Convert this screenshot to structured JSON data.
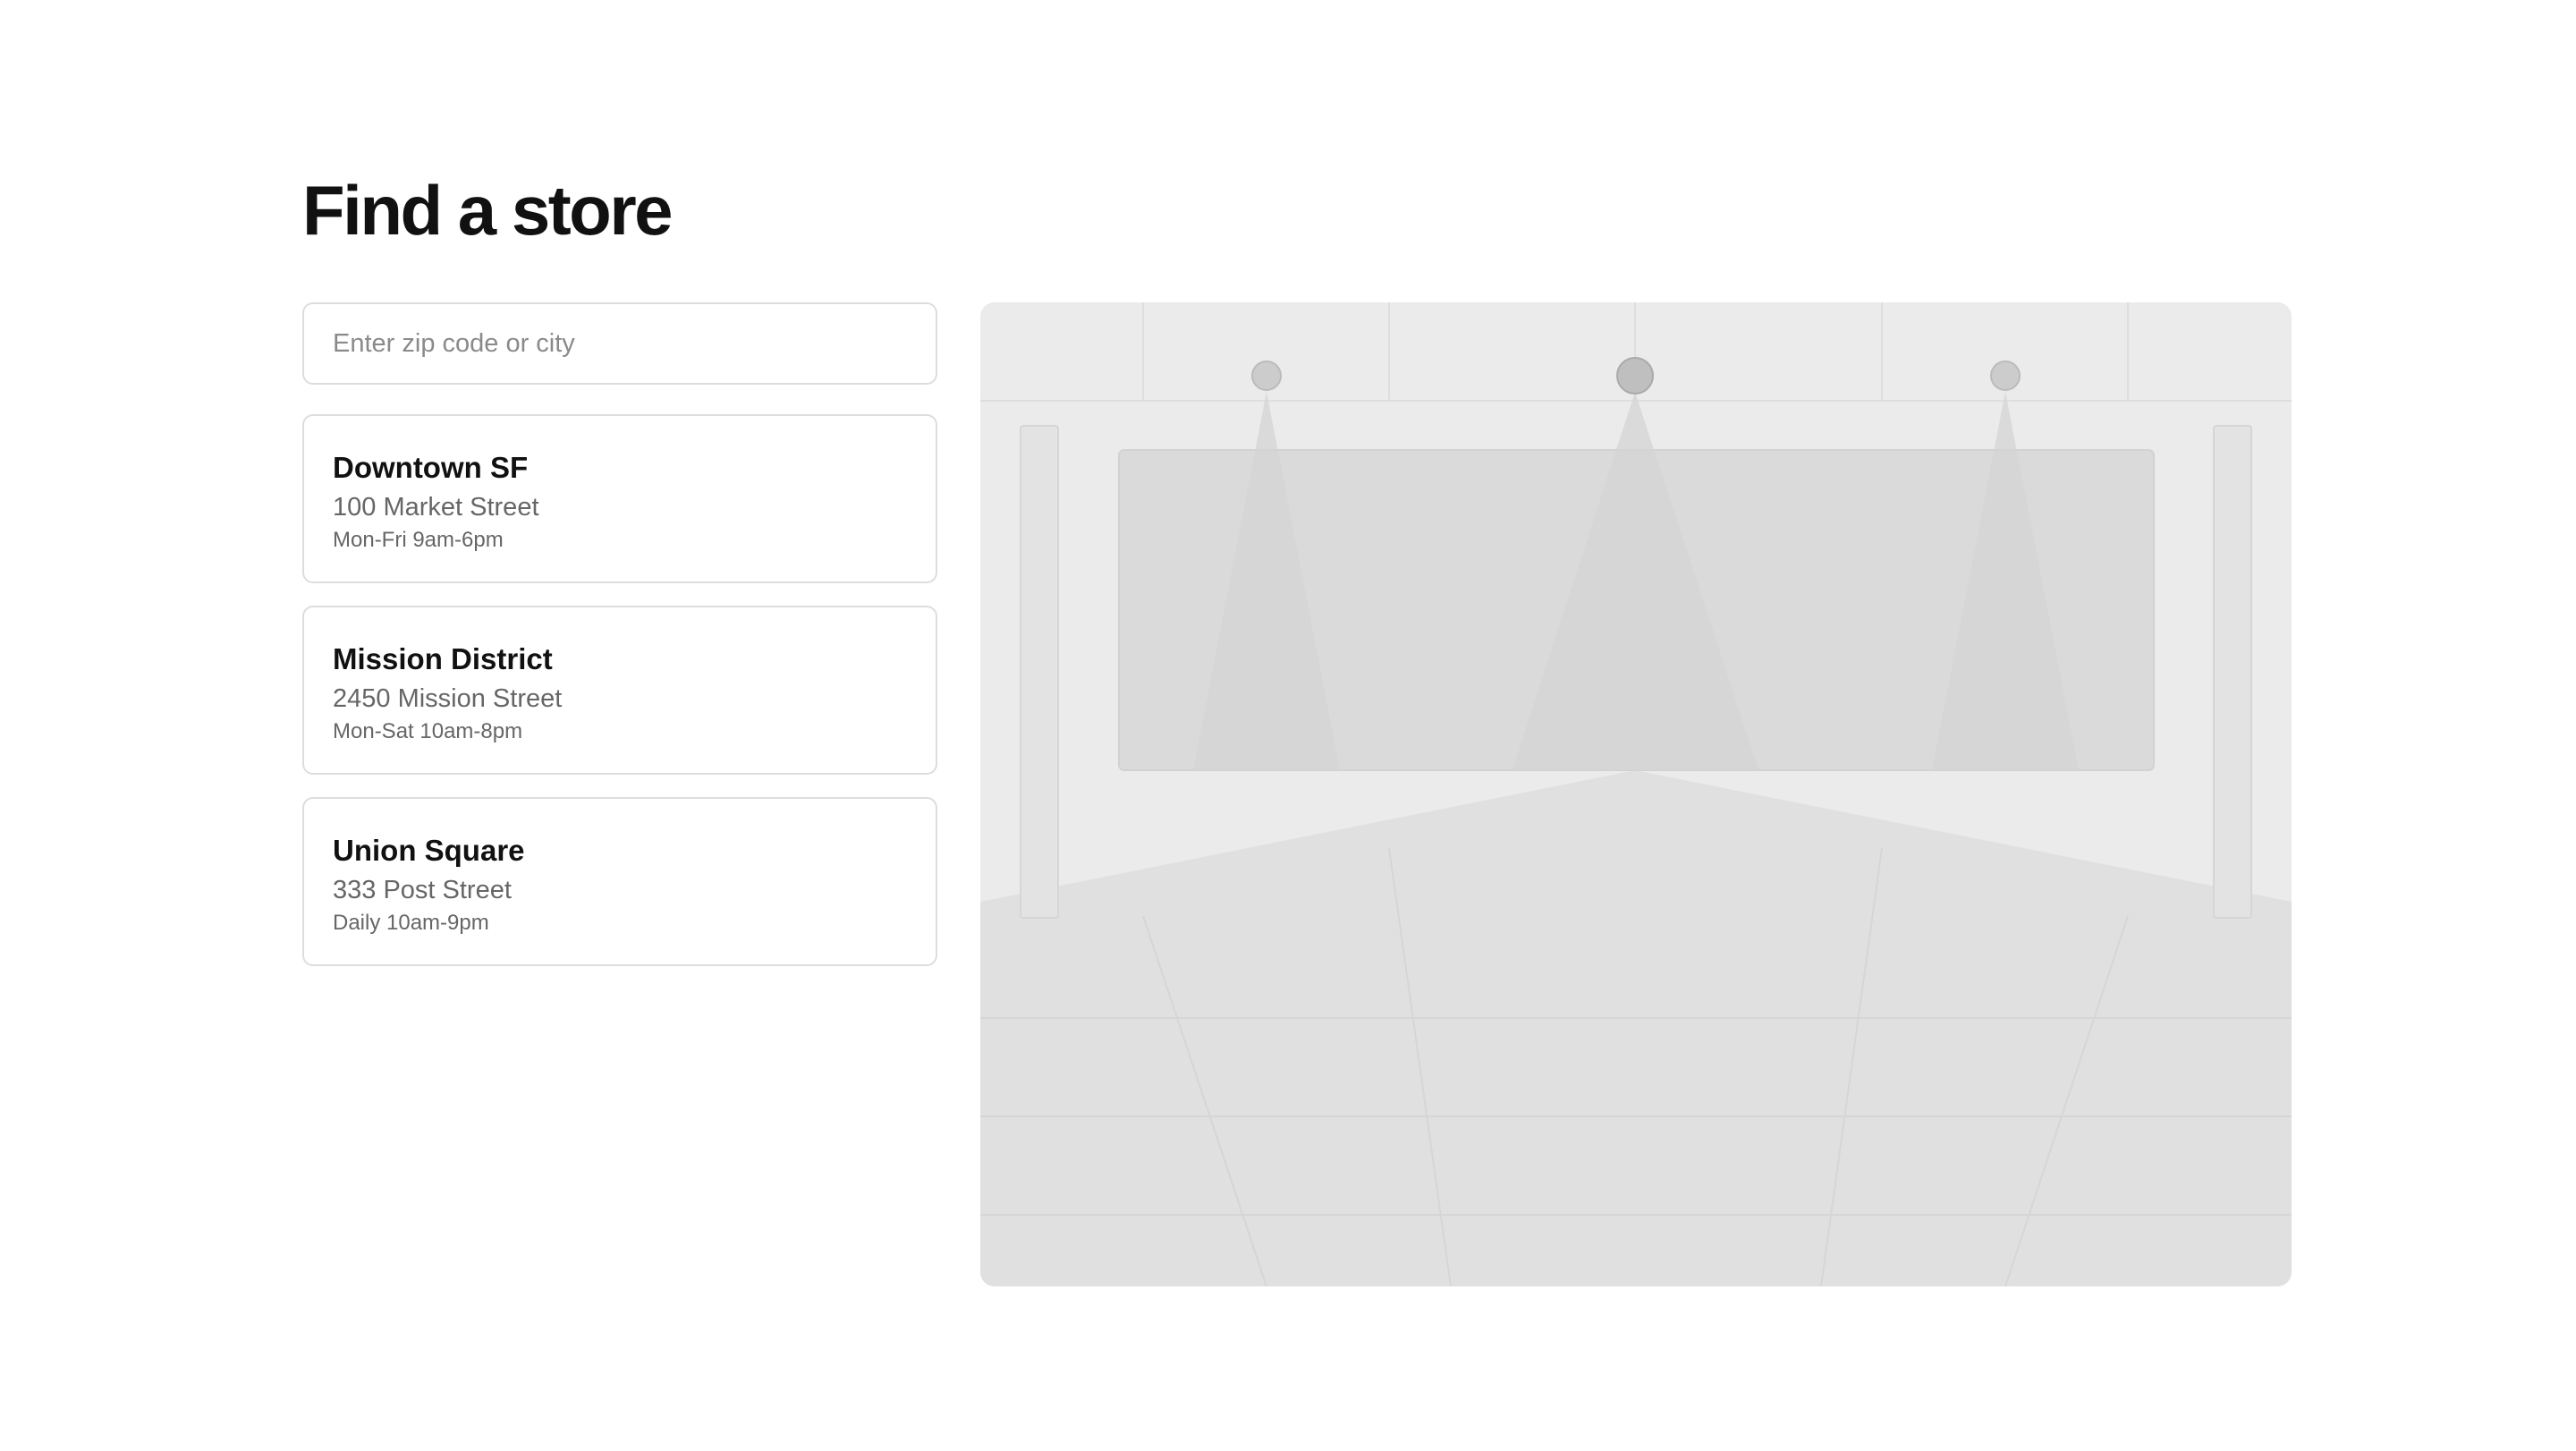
{
  "page": {
    "title": "Find a store"
  },
  "search": {
    "placeholder": "Enter zip code or city",
    "value": ""
  },
  "stores": [
    {
      "name": "Downtown SF",
      "address": "100 Market Street",
      "hours": "Mon-Fri 9am-6pm"
    },
    {
      "name": "Mission District",
      "address": "2450 Mission Street",
      "hours": "Mon-Sat 10am-8pm"
    },
    {
      "name": "Union Square",
      "address": "333 Post Street",
      "hours": "Daily 10am-9pm"
    }
  ],
  "map": {
    "icon": "store-interior-illustration",
    "colors": {
      "wall": "#ebebeb",
      "floor": "#e0e0e0",
      "panel": "#dadada",
      "light_beam": "#d4d4d4",
      "lamp": "#c8c8c8"
    }
  }
}
